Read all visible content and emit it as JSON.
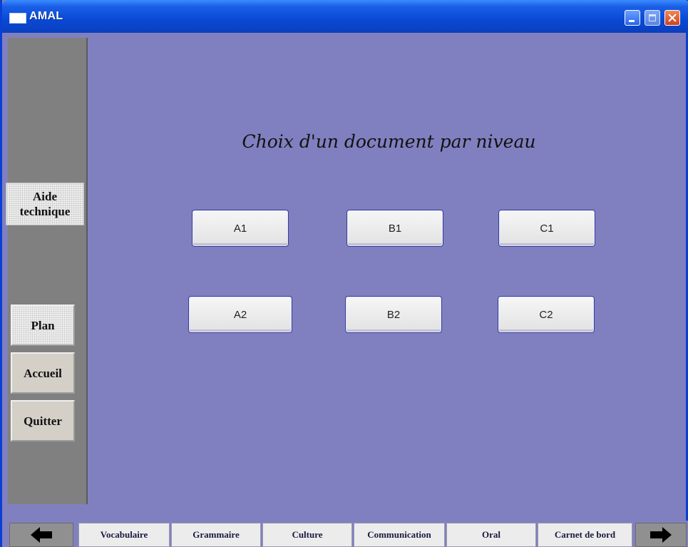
{
  "window": {
    "title": "AMAL"
  },
  "sidebar": {
    "aide_technique": "Aide technique",
    "plan": "Plan",
    "accueil": "Accueil",
    "quitter": "Quitter"
  },
  "main": {
    "title": "Choix d'un document par niveau",
    "levels": [
      "A1",
      "B1",
      "C1",
      "A2",
      "B2",
      "C2"
    ]
  },
  "bottom_nav": {
    "prev_icon": "arrow-left-icon",
    "next_icon": "arrow-right-icon",
    "tabs": [
      "Vocabulaire",
      "Grammaire",
      "Culture",
      "Communication",
      "Oral",
      "Carnet de bord"
    ]
  },
  "colors": {
    "background": "#8080c0",
    "sidebar": "#808080",
    "titlebar": "#0a49d4"
  }
}
